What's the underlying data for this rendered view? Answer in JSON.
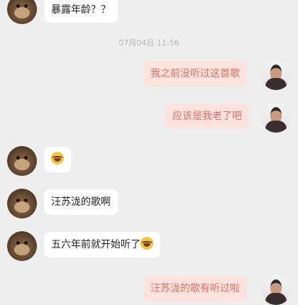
{
  "timestamp": "07月04日 11:56",
  "messages": [
    {
      "side": "left",
      "text": "暴露年龄？？"
    },
    {
      "side": "right",
      "text": "我之前没听过这首歌"
    },
    {
      "side": "right",
      "text": "应该是我老了吧"
    },
    {
      "side": "left",
      "text": "",
      "emoji": "laughing-tears"
    },
    {
      "side": "left",
      "text": "汪苏泷的歌啊"
    },
    {
      "side": "left",
      "text": "五六年前就开始听了",
      "emoji": "laughing-tears"
    },
    {
      "side": "right",
      "text": "汪苏泷的歌有听过啦"
    }
  ],
  "colors": {
    "background": "#eeeeee",
    "bubble_left": "#ffffff",
    "bubble_right": "#fde2dd",
    "text_right": "#e06f5f",
    "timestamp": "#b5b5b5"
  }
}
